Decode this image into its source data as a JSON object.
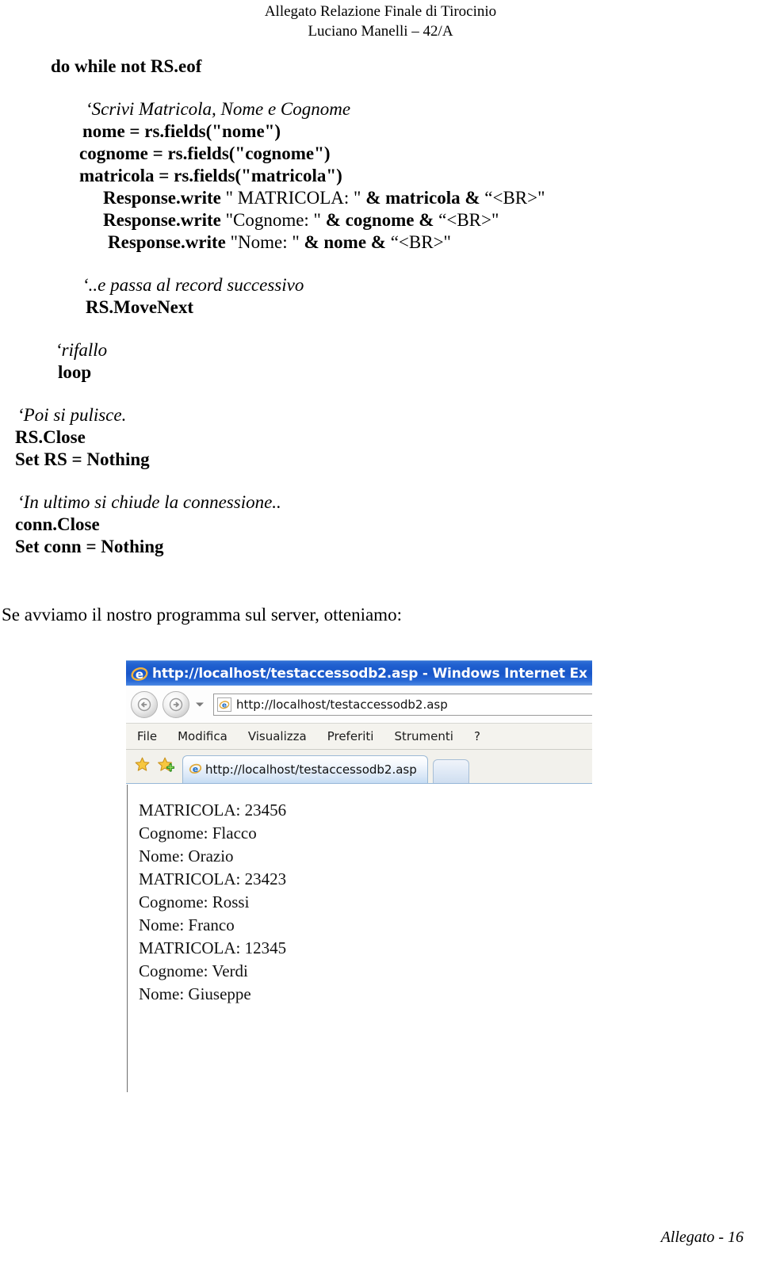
{
  "header": {
    "line1": "Allegato Relazione Finale di Tirocinio",
    "line2": "Luciano Manelli – 42/A"
  },
  "code": {
    "l_do": "do while not RS.eof",
    "c_scrivi": "‘Scrivi Matricola, Nome e Cognome",
    "l_nome": "nome = rs.fields(\"nome\")",
    "l_cognome": "cognome = rs.fields(\"cognome\")",
    "l_matricola": "matricola = rs.fields(\"matricola\")",
    "rw1_a": "Response.write ",
    "rw1_b": "\" MATRICOLA: \"",
    "rw1_c": " & matricola & ",
    "rw1_d": "“<BR>\"",
    "rw2_a": "Response.write ",
    "rw2_b": "\"Cognome: \"",
    "rw2_c": " & cognome & ",
    "rw2_d": "“<BR>\"",
    "rw3_a": "Response.write ",
    "rw3_b": "\"Nome: \"",
    "rw3_c": " & nome & ",
    "rw3_d": "“<BR>\"",
    "c_passa": "‘..e passa al record successivo",
    "l_movenext": "RS.MoveNext",
    "c_rifallo": "‘rifallo",
    "l_loop": "loop",
    "c_pulisce": "‘Poi si pulisce.",
    "l_rsclose": "RS.Close",
    "l_setrs": "Set RS = Nothing",
    "c_connessione": "‘In ultimo si chiude la connessione..",
    "l_connclose": "conn.Close",
    "l_setconn": "Set conn = Nothing"
  },
  "paragraph": {
    "text": "Se avviamo il nostro programma sul server, otteniamo:"
  },
  "browser": {
    "title": "http://localhost/testaccessodb2.asp - Windows Internet Ex",
    "address_value": "http://localhost/testaccessodb2.asp",
    "tab_label": "http://localhost/testaccessodb2.asp",
    "menu": [
      {
        "label": "File"
      },
      {
        "label": "Modifica"
      },
      {
        "label": "Visualizza"
      },
      {
        "label": "Preferiti"
      },
      {
        "label": "Strumenti"
      },
      {
        "label": "?"
      }
    ],
    "page_lines": [
      {
        "text": "MATRICOLA: 23456"
      },
      {
        "text": "Cognome: Flacco"
      },
      {
        "text": "Nome: Orazio"
      },
      {
        "text": "MATRICOLA: 23423"
      },
      {
        "text": "Cognome: Rossi"
      },
      {
        "text": "Nome: Franco"
      },
      {
        "text": "MATRICOLA: 12345"
      },
      {
        "text": "Cognome: Verdi"
      },
      {
        "text": "Nome: Giuseppe"
      }
    ]
  },
  "footer": {
    "text": "Allegato - 16"
  },
  "colors": {
    "titlebar_blue": "#1f5fcf",
    "tab_blue": "#c5dcf3",
    "star_gold": "#f5c53d",
    "star_green": "#7ac943",
    "ie_blue": "#1c6bc4"
  }
}
